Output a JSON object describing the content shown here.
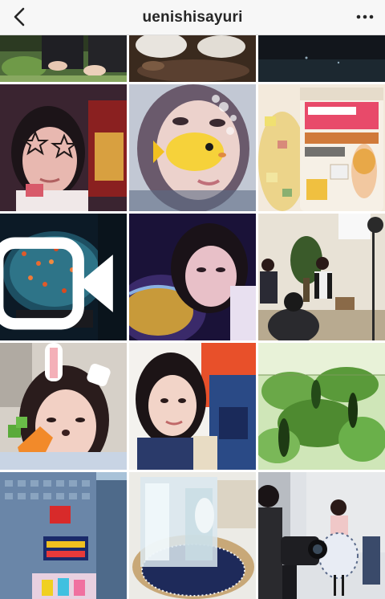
{
  "header": {
    "username": "uenishisayuri",
    "back_icon": "chevron-left-icon",
    "more_icon": "more-horizontal-icon"
  },
  "colors": {
    "header_bg": "#f7f7f7",
    "text": "#262626"
  },
  "grid": {
    "columns": 3,
    "tiles": [
      {
        "id": "top-left-partial",
        "subject": "hands-on-plants"
      },
      {
        "id": "top-middle-partial",
        "subject": "stones"
      },
      {
        "id": "top-right-partial",
        "subject": "dark-scene"
      },
      {
        "id": "selfie-star-glasses",
        "subject": "selfie"
      },
      {
        "id": "selfie-fish-sticker",
        "subject": "selfie"
      },
      {
        "id": "cup-noodle",
        "subject": "food"
      },
      {
        "id": "goldfish-bowl",
        "subject": "aquarium",
        "badge_icon": "video-icon"
      },
      {
        "id": "selfie-aquarium",
        "subject": "selfie"
      },
      {
        "id": "interview-set",
        "subject": "studio"
      },
      {
        "id": "selfie-bunny-carrot",
        "subject": "selfie"
      },
      {
        "id": "selfie-blue-dress",
        "subject": "selfie"
      },
      {
        "id": "bitter-gourd-plant",
        "subject": "plants"
      },
      {
        "id": "tbs-building",
        "subject": "building"
      },
      {
        "id": "ice-block",
        "subject": "ice"
      },
      {
        "id": "camera-crew",
        "subject": "studio"
      }
    ]
  }
}
